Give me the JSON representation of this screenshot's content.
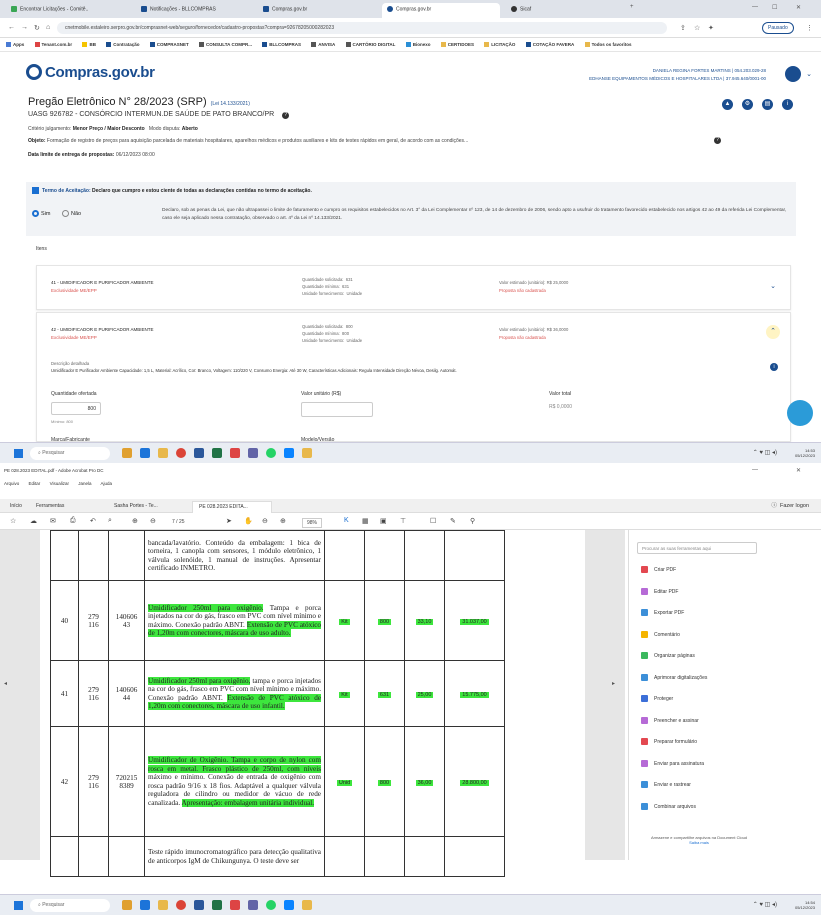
{
  "browser": {
    "tabs": [
      {
        "label": "Encontrar Licitações - Comitê.."
      },
      {
        "label": "Notificações - BLLCOMPRAS"
      },
      {
        "label": "Compras.gov.br"
      },
      {
        "label": "Compras.gov.br"
      },
      {
        "label": "Sicaf"
      }
    ],
    "url": "cnetmobile.estaleiro.serpro.gov.br/comprasnet-web/seguro/fornecedor/cadastro-propostas?compra=92678205000282023",
    "profile_label": "Pausado",
    "bookmarks": [
      "Apps",
      "Tenant.com.br",
      "BB",
      "Contratação",
      "COMPRASNET",
      "CONSULTA COMPR...",
      "BLLCOMPRAS",
      "ANVISA",
      "CARTÓRIO DIGITAL",
      "Bionexo",
      "CERTIDOES",
      "LICITAÇÃO",
      "COTAÇÃO FAVERA",
      "Todos os favoritos"
    ]
  },
  "site": {
    "logo": "Compras.gov.br",
    "user_name": "DANIELA REGINA FORTES MARTINS | 054.203.029-28",
    "user_company": "EDHANSE EQUIPAMENTOS MÉDICOS E HOSPITALARES LTDA | 37.945.640/0001-00"
  },
  "pregao": {
    "title": "Pregão Eletrônico N° 28/2023 (SRP)",
    "law": "(Lei 14.133/2021)",
    "uasg": "UASG 926782 - CONSÓRCIO INTERMUN.DE SAÚDE DE PATO BRANCO/PR",
    "criterio_label": "Critério julgamento:",
    "criterio_value": "Menor Preço / Maior Desconto",
    "modo_label": "Modo disputa:",
    "modo_value": "Aberto",
    "objeto_label": "Objeto:",
    "objeto_value": "Formação de registro de preços para aquisição parcelada de materiais hospitalares, aparelhos médicos e produtos auxiliares e kits de testes rápidos em geral, de acordo com as condições...",
    "data_label": "Data limite de entrega de propostas:",
    "data_value": "06/12/2023 08:00"
  },
  "termo": {
    "label": "Termo de Aceitação:",
    "text": "Declaro que cumpro e estou ciente de todas as declarações contidas no termo de aceitação.",
    "sim": "Sim",
    "nao": "Não",
    "declaracao": "Declaro, sob as penas da Lei, que não ultrapassei o limite de faturamento e cumpro os requisitos estabelecidos no Art. 3° da Lei Complementar nº 123, de 14 de dezembro de 2006, sendo apto a usufruir do tratamento favorecido estabelecido nos artigos 42 ao 49 da referida Lei Complementar, caso ele seja aplicado nessa contratação, observado o art. 4º da Lei nº 14.133/2021."
  },
  "itens_label": "Itens",
  "items": [
    {
      "name": "41 - UMIDIFICADOR E PURIFICADOR AMBIENTE",
      "sub": "Exclusividade ME/EPP",
      "qty": "Quantidade solicitada:  631\nQuantidade mínima:  631\nUnidade fornecimento:  Unidade",
      "valor": "Valor estimado (unitário):  R$ 25,0000",
      "prop": "Proposta não cadastrada"
    },
    {
      "name": "42 - UMIDIFICADOR E PURIFICADOR AMBIENTE",
      "sub": "Exclusividade ME/EPP",
      "qty": "Quantidade solicitada:  800\nQuantidade mínima:  800\nUnidade fornecimento:  Unidade",
      "valor": "Valor estimado (unitário):  R$ 36,0000",
      "prop": "Proposta não cadastrada",
      "desc_label": "Descrição detalhada",
      "desc": "Umidificador E Purificador Ambiente Capacidade: 1,5 L, Material: Acrílico, Cor: Branco, Voltagem: 110/220 V, Consumo Energia: Até 30 W, Características Adicionais: Regula Intensidade Direção Névoa, Desilg. Automát."
    }
  ],
  "form": {
    "qtd_label": "Quantidade ofertada",
    "qtd_value": "800",
    "qtd_min": "Mínimo: 800",
    "valor_unit_label": "Valor unitário (R$)",
    "valor_total_label": "Valor total",
    "valor_total_value": "R$ 0,0000",
    "marca_label": "Marca/Fabricante",
    "modelo_label": "Modelo/Versão"
  },
  "taskbar": {
    "search": "Pesquisar",
    "time1": "14:53",
    "date1": "05/12/2023",
    "time2": "14:54",
    "date2": "05/12/2023"
  },
  "acrobat": {
    "title": "PE 028.2023 EDITAL.pdf - Adobe Acrobat Pro DC",
    "menu": [
      "Arquivo",
      "Editar",
      "Visualizar",
      "Janela",
      "Ajuda"
    ],
    "tabs": [
      "Início",
      "Ferramentas",
      "Sasha Portes - Te...",
      "PE 028.2023 EDITA..."
    ],
    "sign_in": "Fazer logon",
    "zoom": "98%",
    "page_nav": "7 / 25",
    "tools_search": "Procurar as suas ferramentas aqui",
    "tools": [
      "Criar PDF",
      "Editar PDF",
      "Exportar PDF",
      "Comentário",
      "Organizar páginas",
      "Aprimorar digitalizações",
      "Proteger",
      "Preencher e assinar",
      "Preparar formulário",
      "Enviar para assinatura",
      "Enviar e rastrear",
      "Combinar arquivos"
    ],
    "tools_colors": [
      "#e34850",
      "#b66ad6",
      "#3c8fd8",
      "#f5b400",
      "#3bb85e",
      "#3c8fd8",
      "#3c6fd8",
      "#b66ad6",
      "#e34850",
      "#b66ad6",
      "#3c8fd8",
      "#3c8fd8"
    ],
    "footer": "Armazene e compartilhe arquivos na Document Cloud",
    "footer_link": "Saiba mais"
  },
  "pdf_rows": [
    {
      "num": "",
      "cod": "",
      "cat": "",
      "desc": "bancada/lavatório. Conteúdo da embalagem: 1 bica de torneira, 1 canopla com sensores, 1 módulo eletrônico, 1 válvula solenóide, 1 manual de instruções. Apresentar certificado INMETRO.",
      "hl": "",
      "rest": "",
      "hl2": "",
      "un": "",
      "qtd": "",
      "vu": "",
      "vt": ""
    },
    {
      "num": "40",
      "cod": "279 116",
      "cat": "140606 43",
      "hl": "Umidificador 250ml para oxigênio.",
      "rest": " Tampa e porca injetados na cor do gás, frasco em PVC com nível mínimo e máximo. Conexão padrão ABNT. ",
      "hl2": "Extensão de PVC atóxico de 1,20m com conectores, máscara de uso adulto.",
      "un": "Kit",
      "qtd": "800",
      "vu": "33,10",
      "vt": "31.037,00"
    },
    {
      "num": "41",
      "cod": "279 116",
      "cat": "140606 44",
      "hl": "Umidificador 250ml para oxigênio,",
      "rest": " tampa e porca injetados na cor do gás, frasco em PVC com nível mínimo e máximo. Conexão padrão ABNT. ",
      "hl2": "Extensão de PVC atóxico de 1,20m com conectores, máscara de uso infantil.",
      "un": "Kit",
      "qtd": "631",
      "vu": "25,00",
      "vt": "15.775,00"
    },
    {
      "num": "42",
      "cod": "279 116",
      "cat": "720215 8389",
      "hl": "Umidificador de Oxigênio. Tampa e corpo de nylon com rosca em metal. Frasco plástico de 250ml, com níveis",
      "rest": " máximo e mínimo. Conexão de entrada de oxigênio com rosca padrão 9/16 x 18 fios. Adaptável a qualquer válvula reguladora de cilindro ou medidor de vácuo de rede canalizada. ",
      "hl2": "Apresentação: embalagem unitária individual.",
      "un": "Unid",
      "qtd": "800",
      "vu": "36,00",
      "vt": "28.800,00"
    },
    {
      "num": "",
      "cod": "",
      "cat": "",
      "desc": "Teste rápido imunocromatográfico para detecção qualitativa de anticorpos IgM de Chikungunya. O teste deve ser",
      "hl": "",
      "rest": "",
      "hl2": "",
      "un": "",
      "qtd": "",
      "vu": "",
      "vt": ""
    }
  ]
}
